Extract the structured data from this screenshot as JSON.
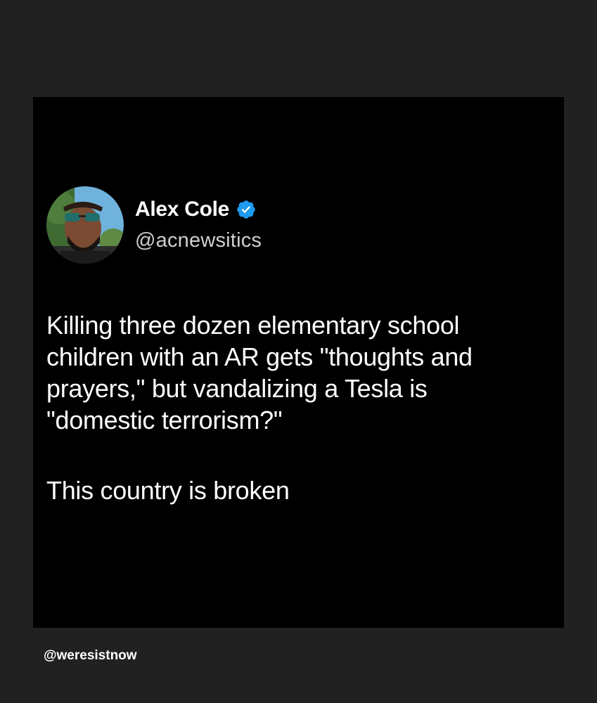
{
  "post": {
    "author_name": "Alex Cole",
    "author_handle": "@acnewsitics",
    "verified_icon": "verified-badge-icon",
    "avatar_icon": "profile-photo",
    "lines": [
      "Killing three dozen elementary school",
      "children with an AR gets \"thoughts and",
      "prayers,\" but vandalizing a Tesla is",
      "\"domestic terrorism?\""
    ],
    "closing_line": "This country is broken"
  },
  "credit": {
    "handle": "@weresistnow"
  },
  "colors": {
    "outer_background": "#212121",
    "card_background": "#000000",
    "text": "#ffffff",
    "handle_text": "#cfcfcf",
    "verified_blue": "#1d9bf0"
  }
}
